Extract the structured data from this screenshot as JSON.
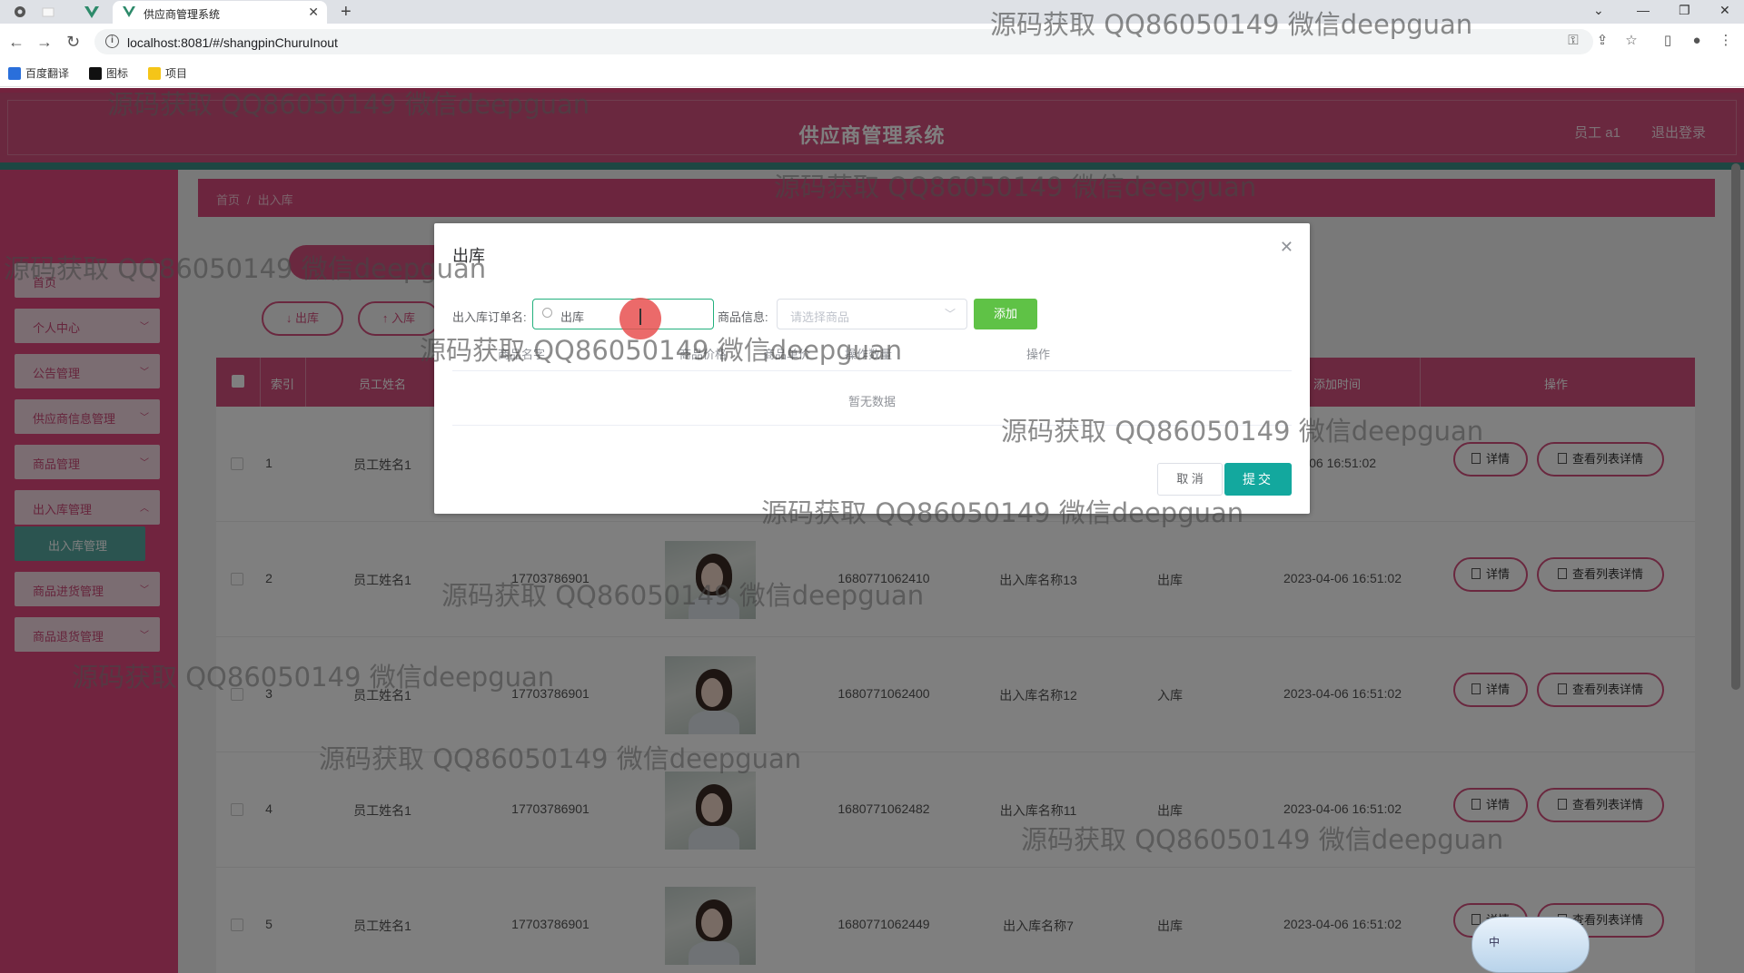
{
  "browser": {
    "tab_title": "供应商管理系统",
    "url": "localhost:8081/#/shangpinChuruInout",
    "bookmarks": [
      {
        "label": "百度翻译"
      },
      {
        "label": "图标"
      },
      {
        "label": "项目"
      }
    ]
  },
  "header": {
    "brand": "供应商管理系统",
    "user": "员工 a1",
    "logout": "退出登录"
  },
  "sidebar": {
    "items": [
      {
        "label": "首页"
      },
      {
        "label": "个人中心"
      },
      {
        "label": "公告管理"
      },
      {
        "label": "供应商信息管理"
      },
      {
        "label": "商品管理"
      },
      {
        "label": "出入库管理"
      },
      {
        "label": "出入库管理"
      },
      {
        "label": "商品进货管理"
      },
      {
        "label": "商品退货管理"
      }
    ]
  },
  "breadcrumb": {
    "home": "首页",
    "current": "出入库"
  },
  "actions": {
    "out": "出库",
    "in": "入库"
  },
  "table": {
    "headers": [
      "索引",
      "员工姓名",
      "添加时间",
      "操作"
    ],
    "rows": [
      {
        "index": "1",
        "name": "员工姓名1",
        "phone": "",
        "code": "",
        "title": "",
        "type": "",
        "time": "04-06 16:51:02"
      },
      {
        "index": "2",
        "name": "员工姓名1",
        "phone": "17703786901",
        "code": "1680771062410",
        "title": "出入库名称13",
        "type": "出库",
        "time": "2023-04-06 16:51:02"
      },
      {
        "index": "3",
        "name": "员工姓名1",
        "phone": "17703786901",
        "code": "1680771062400",
        "title": "出入库名称12",
        "type": "入库",
        "time": "2023-04-06 16:51:02"
      },
      {
        "index": "4",
        "name": "员工姓名1",
        "phone": "17703786901",
        "code": "1680771062482",
        "title": "出入库名称11",
        "type": "出库",
        "time": "2023-04-06 16:51:02"
      },
      {
        "index": "5",
        "name": "员工姓名1",
        "phone": "17703786901",
        "code": "1680771062449",
        "title": "出入库名称7",
        "type": "出库",
        "time": "2023-04-06 16:51:02"
      }
    ],
    "detail_btn": "详情",
    "list_btn": "查看列表详情"
  },
  "dialog": {
    "title": "出库",
    "order_label": "出入库订单名:",
    "order_value": "出库",
    "goods_label": "商品信息:",
    "goods_placeholder": "请选择商品",
    "add_btn": "添加",
    "columns": [
      "商品名字",
      "商品价格",
      "商品单价",
      "操作数量",
      "操作"
    ],
    "empty_text": "暂无数据",
    "cancel_btn": "取 消",
    "submit_btn": "提交"
  },
  "ime_label": "中",
  "watermarks": [
    "源码获取 QQ86050149 微信deepguan",
    "源码获取 QQ86050149 微信deepguan",
    "源码获取 QQ86050149 微信deepguan",
    "源码获取 QQ86050149 微信deepguan",
    "源码获取 QQ86050149 微信deepguan",
    "源码获取 QQ86050149 微信deepguan",
    "源码获取 QQ86050149 微信deepguan",
    "源码获取 QQ86050149 微信deepguan",
    "源码获取 QQ86050149 微信deepguan",
    "源码获取 QQ86050149 微信deepguan",
    "源码获取 QQ86050149 微信deepguan"
  ]
}
